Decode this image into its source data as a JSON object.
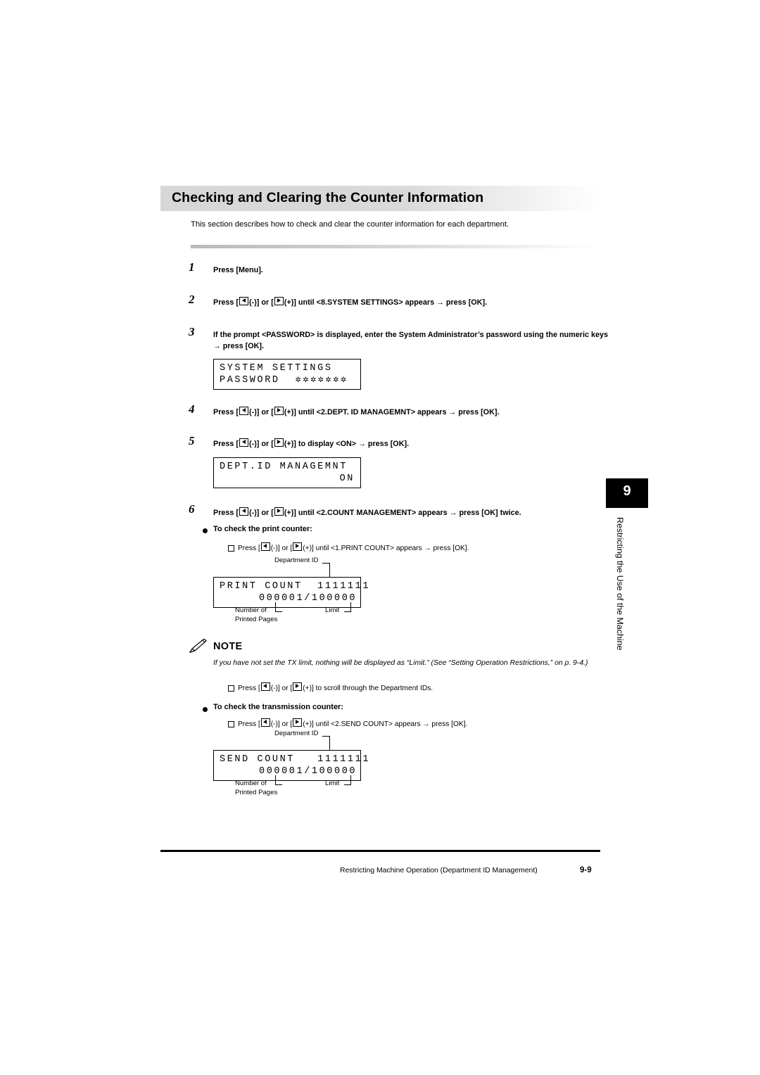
{
  "header": {
    "title": "Checking and Clearing the Counter Information",
    "intro": "This section describes how to check and clear the counter information for each department."
  },
  "steps": [
    {
      "num": "1",
      "text": "Press [Menu]."
    },
    {
      "num": "2",
      "text_pre": "Press [",
      "text_mid": "(-)] or [",
      "text_post": "(+)] until <8.SYSTEM SETTINGS> appears → press [OK]."
    },
    {
      "num": "3",
      "text": "If the prompt <PASSWORD> is displayed, enter the System Administrator’s password using the numeric keys → press [OK]."
    },
    {
      "num": "4",
      "text_pre": "Press [",
      "text_mid": "(-)] or [",
      "text_post": "(+)] until <2.DEPT. ID MANAGEMNT> appears → press [OK]."
    },
    {
      "num": "5",
      "text_pre": "Press [",
      "text_mid": "(-)] or [",
      "text_post": "(+)] to display <ON> → press [OK]."
    },
    {
      "num": "6",
      "text_pre": "Press [",
      "text_mid": "(-)] or [",
      "text_post": "(+)] until <2.COUNT MANAGEMENT> appears → press [OK] twice."
    }
  ],
  "lcd_password": {
    "line1": "SYSTEM SETTINGS",
    "line2": "PASSWORD",
    "line2_right": "✲✲✲✲✲✲✲"
  },
  "lcd_dept": {
    "line1": "DEPT.ID MANAGEMNT",
    "line2": "ON"
  },
  "lcd_print": {
    "line1": "PRINT COUNT  1111111",
    "line2": "000001/100000"
  },
  "lcd_send": {
    "line1": "SEND COUNT   1111111",
    "line2": "000001/100000"
  },
  "callouts": {
    "department_id": "Department ID",
    "number_of_printed_pages_l1": "Number of",
    "number_of_printed_pages_l2": "Printed Pages",
    "limit": "Limit"
  },
  "print_counter": {
    "heading": "To check the print counter:",
    "item_pre": "Press [",
    "item_mid": "(-)] or [",
    "item_post": "(+)] until <1.PRINT COUNT> appears → press [OK]."
  },
  "note": {
    "label": "NOTE",
    "body": "If you have not set the TX limit, nothing will be displayed as “Limit.” (See “Setting Operation Restrictions,” on p. 9-4.)",
    "scroll_pre": "Press [",
    "scroll_mid": "(-)] or [",
    "scroll_post": "(+)] to scroll through the Department IDs."
  },
  "transmission_counter": {
    "heading": "To check the transmission counter:",
    "item_pre": "Press [",
    "item_mid": "(-)] or [",
    "item_post": "(+)] until <2.SEND COUNT> appears → press [OK]."
  },
  "side_tab": {
    "chapter": "9",
    "label": "Restricting the Use of the Machine"
  },
  "footer": {
    "text": "Restricting Machine Operation (Department ID Management)",
    "page": "9-9"
  }
}
